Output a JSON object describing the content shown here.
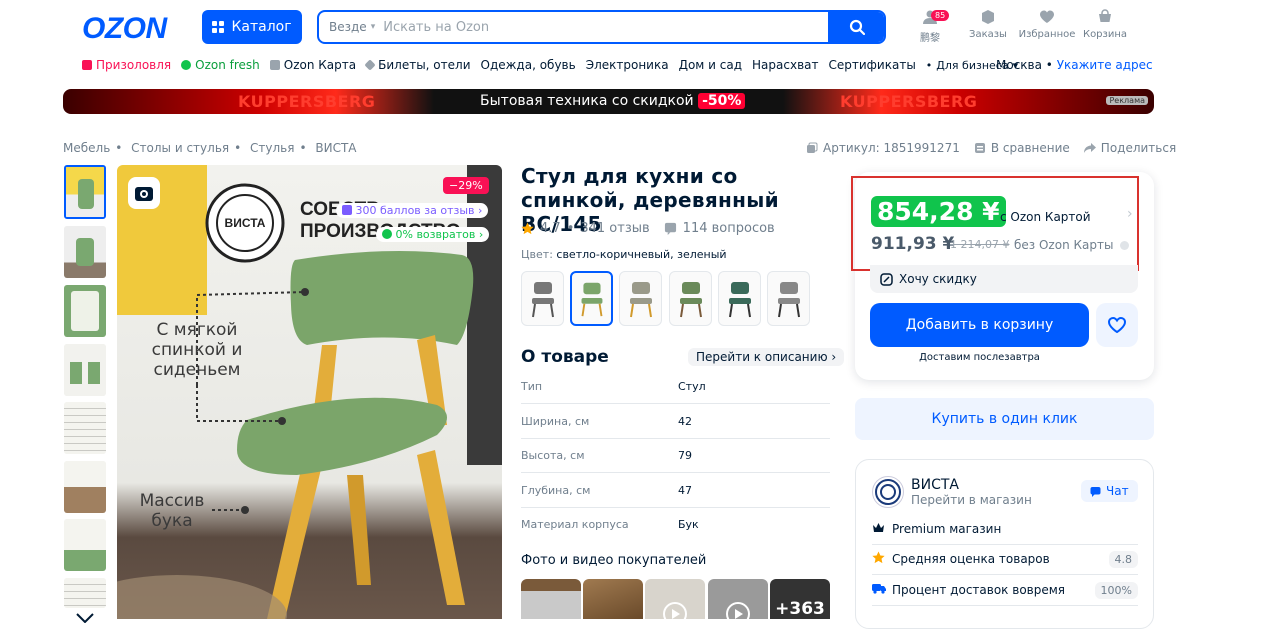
{
  "header": {
    "logo": "OZON",
    "catalog_label": "Каталог",
    "search_scope": "Везде",
    "search_placeholder": "Искать на Ozon",
    "icons": [
      {
        "label": "鹏黎",
        "badge": "85",
        "icon": "user-icon"
      },
      {
        "label": "Заказы",
        "icon": "box-icon"
      },
      {
        "label": "Избранное",
        "icon": "heart-icon"
      },
      {
        "label": "Корзина",
        "icon": "cart-icon"
      }
    ]
  },
  "nav": {
    "items": [
      {
        "label": "Призоловля",
        "icon": "gift-icon",
        "color": "#f91155"
      },
      {
        "label": "Ozon fresh",
        "icon": "fresh-icon",
        "color": "#10c44c"
      },
      {
        "label": "Ozon Карта",
        "icon": "card-icon",
        "color": "#707f8d"
      },
      {
        "label": "Билеты, отели",
        "icon": "plane-icon",
        "color": "#707f8d"
      },
      {
        "label": "Одежда, обувь"
      },
      {
        "label": "Электроника"
      },
      {
        "label": "Дом и сад"
      },
      {
        "label": "Нарасхват"
      },
      {
        "label": "Сертификаты"
      },
      {
        "label": "Для бизнеса"
      }
    ],
    "city": "Москва",
    "address_link": "Укажите адрес"
  },
  "banner": {
    "brand_left": "KUPPERSBERG",
    "text": "Бытовая техника со скидкой",
    "percent": "-50%",
    "brand_right": "KUPPERSBERG",
    "ad_label": "Реклама"
  },
  "breadcrumb": [
    "Мебель",
    "Столы и стулья",
    "Стулья",
    "ВИСТА"
  ],
  "tools": {
    "article": "Артикул: 1851991271",
    "compare": "В сравнение",
    "share": "Поделиться"
  },
  "image": {
    "discount_badge": "−29%",
    "bonus_badge": "300 баллов за отзыв",
    "returns_badge": "0% возвратов",
    "brand_text": "ВИСТА",
    "headline": "СОБСТВЕННОЕ ПРОИЗВОДСТВО",
    "callout_1": "С мягкой спинкой и сиденьем",
    "callout_2": "Массив бука"
  },
  "product": {
    "title": "Стул для кухни со спинкой, деревянный ВС/145",
    "rating": "4.7",
    "reviews": "341 отзыв",
    "questions": "114 вопросов",
    "color_label": "Цвет:",
    "color_value": "светло-коричневый, зеленый"
  },
  "about": {
    "title": "О товаре",
    "link": "Перейти к описанию",
    "specs": [
      {
        "key": "Тип",
        "value": "Стул"
      },
      {
        "key": "Ширина, см",
        "value": "42"
      },
      {
        "key": "Высота, см",
        "value": "79"
      },
      {
        "key": "Глубина, см",
        "value": "47"
      },
      {
        "key": "Материал корпуса",
        "value": "Бук"
      }
    ]
  },
  "photos": {
    "title": "Фото и видео покупателей",
    "more_count": "+363"
  },
  "price": {
    "ozon_card_price": "854,28 ¥",
    "ozon_card_label": "с Ozon Картой",
    "regular_price": "911,93 ¥",
    "old_price": "1 214,07 ¥",
    "regular_label": "без Ozon Карты",
    "want_discount": "Хочу скидку",
    "add_to_cart": "Добавить в корзину",
    "delivery": "Доставим послезавтра",
    "buy_one_click": "Купить в один клик"
  },
  "seller": {
    "name": "ВИСТА",
    "link": "Перейти в магазин",
    "chat": "Чат",
    "rows": [
      {
        "label": "Premium магазин",
        "icon": "crown-icon"
      },
      {
        "label": "Средняя оценка товаров",
        "value": "4.8",
        "icon": "star-icon"
      },
      {
        "label": "Процент доставок вовремя",
        "value": "100%",
        "icon": "truck-icon"
      }
    ]
  },
  "colors": {
    "accent": "#005bff",
    "green": "#10c44c",
    "pink": "#f91155",
    "highlight_border": "#d9322e"
  }
}
